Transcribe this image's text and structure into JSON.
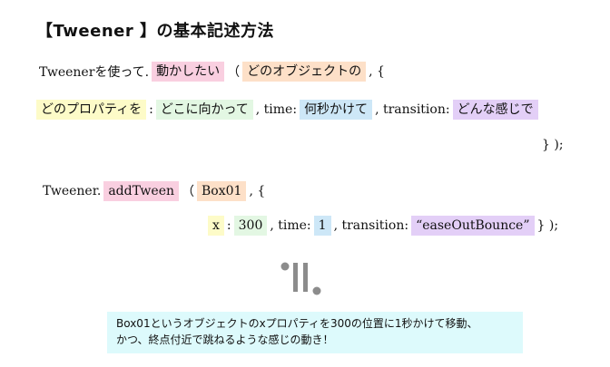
{
  "title": "【Tweener 】の基本記述方法",
  "syntax": {
    "line1": {
      "p1": "Tweenerを使って.",
      "motion": "動かしたい",
      "p2": "（",
      "object": "どのオブジェクトの",
      "p3": ", {"
    },
    "line2": {
      "property": "どのプロパティを",
      "p1": ":",
      "target": "どこに向かって",
      "p2": ", time:",
      "seconds": "何秒かけて",
      "p3": ", transition:",
      "feel": "どんな感じで"
    },
    "line3": {
      "close": "} );"
    }
  },
  "example": {
    "line1": {
      "p1": "Tweener.",
      "method": "addTween",
      "p2": "（",
      "object": "Box01",
      "p3": ", {"
    },
    "line2": {
      "prop": "x",
      "p1": ":",
      "value": "300",
      "p2": ", time:",
      "seconds": "1",
      "p3": ", transition:",
      "transition": "“easeOutBounce”",
      "p4": "} );"
    }
  },
  "summary": {
    "line1": "Box01というオブジェクトのxプロパティを300の位置に1秒かけて移動、",
    "line2": "かつ、終点付近で跳ねるような感じの動き！"
  },
  "colors": {
    "pink": "#f9cfe0",
    "peach": "#fde0c8",
    "yellow": "#fdfbc8",
    "green": "#e3f7e3",
    "blue": "#cde7f7",
    "purple": "#e3cff7",
    "summary_bg": "#ddfafc",
    "arrow": "#8c8c8c"
  },
  "icons": {
    "arrow": "down-arrow-icon"
  }
}
